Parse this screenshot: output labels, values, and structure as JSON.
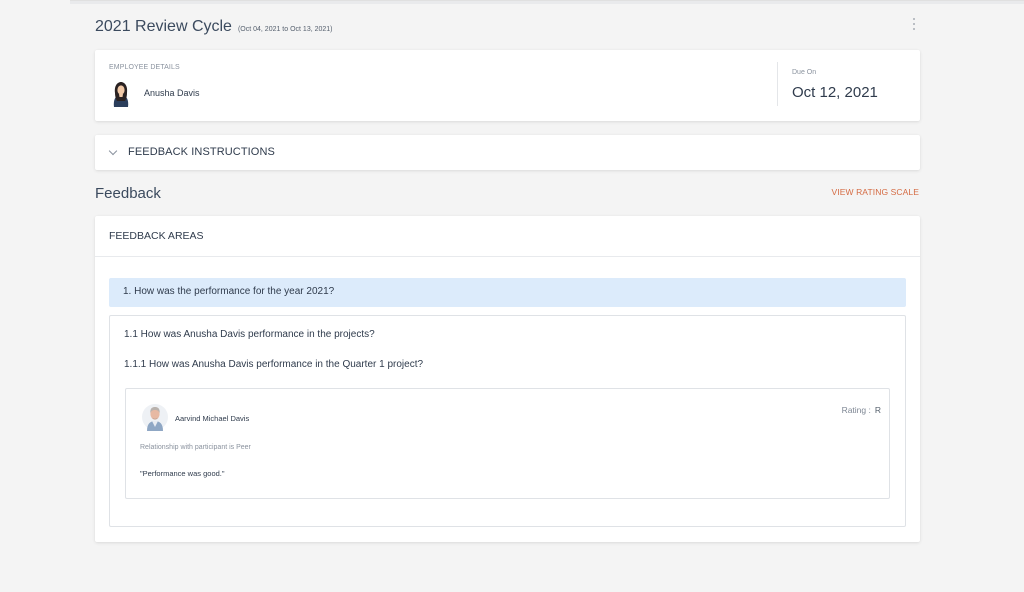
{
  "header": {
    "title": "2021 Review Cycle",
    "date_range": "(Oct 04, 2021 to Oct 13, 2021)",
    "menu_icon": "more-vertical-icon"
  },
  "employee": {
    "label": "EMPLOYEE DETAILS",
    "name": "Anusha Davis",
    "due_label": "Due On",
    "due_date": "Oct 12, 2021"
  },
  "instructions": {
    "label": "FEEDBACK INSTRUCTIONS",
    "expand_icon": "chevron-down-icon"
  },
  "feedback": {
    "title": "Feedback",
    "rating_scale_link": "VIEW RATING SCALE",
    "rating_link_color": "#d56b43",
    "areas_label": "FEEDBACK AREAS",
    "question": "1. How was the performance for the year 2021?",
    "question_band_color": "#dcebfb",
    "sub_questions": [
      "1.1 How was Anusha Davis performance in the projects?",
      "1.1.1 How was Anusha Davis performance in the Quarter 1 project?"
    ],
    "response": {
      "reviewer_name": "Aarvind Michael Davis",
      "rating_label": "Rating :",
      "rating_value": "R",
      "relationship": "Relationship with participant is Peer",
      "comment": "\"Performance was good.\""
    }
  }
}
